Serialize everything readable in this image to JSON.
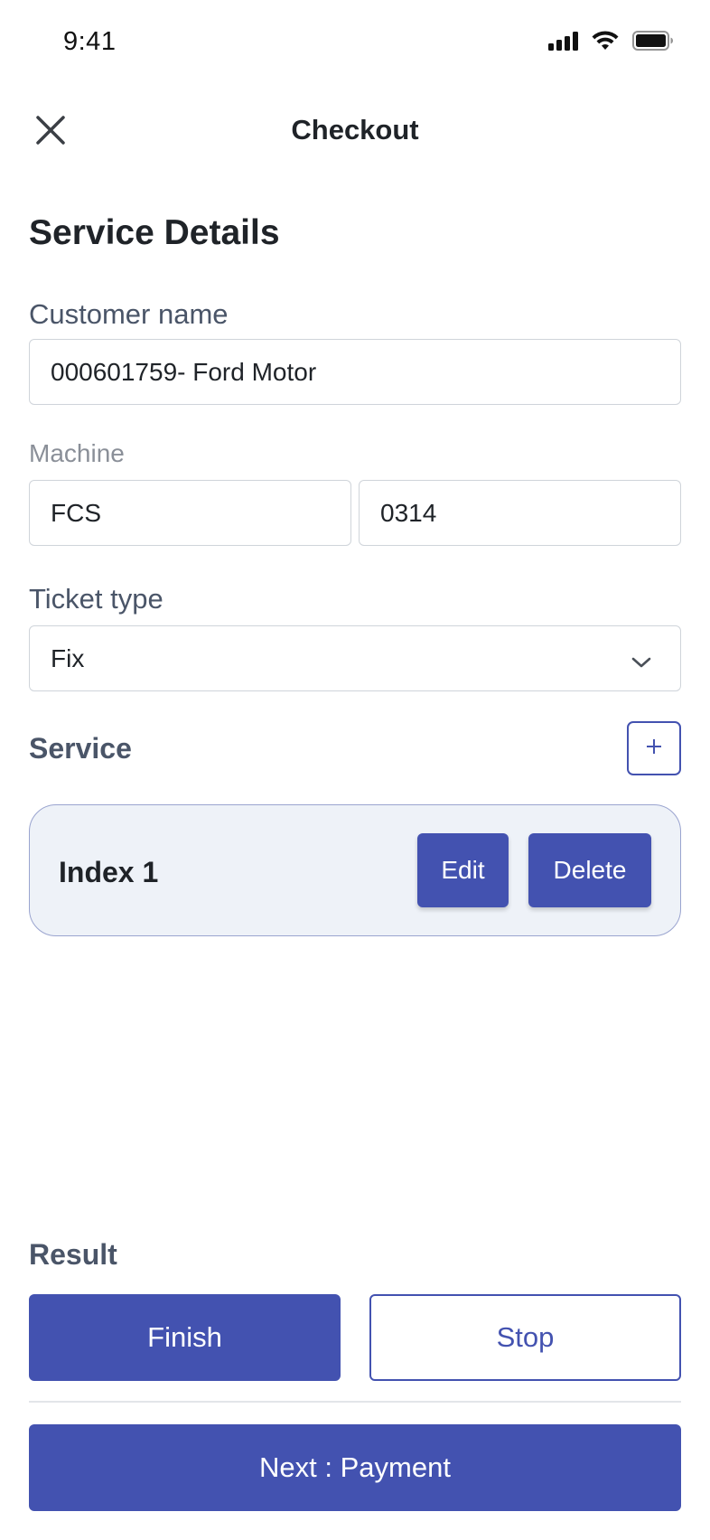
{
  "status_bar": {
    "time": "9:41",
    "icons": [
      "cellular-signal-icon",
      "wifi-icon",
      "battery-icon"
    ]
  },
  "nav": {
    "close_icon": "close-icon",
    "title": "Checkout"
  },
  "page": {
    "section_title": "Service Details"
  },
  "form": {
    "customer": {
      "label": "Customer name",
      "value": "000601759- Ford Motor"
    },
    "machine": {
      "label": "Machine",
      "model_value": "FCS",
      "number_value": "0314"
    },
    "ticket_type": {
      "label": "Ticket type",
      "selected": "Fix",
      "icon": "chevron-down-icon"
    }
  },
  "service": {
    "label": "Service",
    "add_icon": "plus-icon",
    "items": [
      {
        "title": "Index 1",
        "edit_label": "Edit",
        "delete_label": "Delete"
      }
    ]
  },
  "result": {
    "label": "Result",
    "finish_label": "Finish",
    "stop_label": "Stop"
  },
  "footer": {
    "next_label": "Next : Payment"
  },
  "colors": {
    "accent": "#4352b0",
    "card_bg": "#eef2f8",
    "card_border": "#9aa4cf",
    "label_text": "#4a5568"
  }
}
